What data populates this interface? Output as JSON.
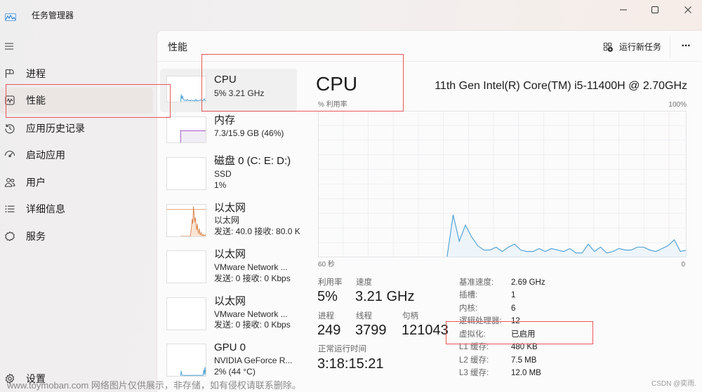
{
  "window": {
    "title": "任务管理器",
    "app_icon": "task-manager-icon"
  },
  "sidebar": {
    "menu_icon": "hamburger-icon",
    "items": [
      {
        "label": "进程",
        "icon": "processes-icon",
        "selected": false
      },
      {
        "label": "性能",
        "icon": "performance-icon",
        "selected": true
      },
      {
        "label": "应用历史记录",
        "icon": "history-icon",
        "selected": false
      },
      {
        "label": "启动应用",
        "icon": "startup-icon",
        "selected": false
      },
      {
        "label": "用户",
        "icon": "users-icon",
        "selected": false
      },
      {
        "label": "详细信息",
        "icon": "details-icon",
        "selected": false
      },
      {
        "label": "服务",
        "icon": "services-icon",
        "selected": false
      }
    ],
    "settings": {
      "label": "设置",
      "icon": "gear-icon"
    }
  },
  "header": {
    "title": "性能",
    "run_new_task": "运行新任务",
    "more": "···"
  },
  "devices": [
    {
      "name": "CPU",
      "line1": "5% 3.21 GHz",
      "line2": "",
      "selected": true,
      "color": "#4a9fd4",
      "fill": "#e9f2fa",
      "graph": {
        "source": "chart_data"
      }
    },
    {
      "name": "内存",
      "line1": "7.3/15.9 GB (46%)",
      "line2": "",
      "selected": false,
      "color": "#9a48c2",
      "fill": "#f1edf4",
      "graph": {
        "values": [
          46,
          46,
          46,
          46,
          46,
          46,
          46,
          46,
          46,
          46,
          46,
          46,
          46,
          46,
          46,
          46,
          46,
          46,
          46,
          46,
          46,
          46,
          46,
          46,
          46,
          46,
          46,
          46,
          46,
          46,
          46,
          46,
          46,
          46,
          46,
          46,
          46,
          46,
          46,
          46
        ]
      }
    },
    {
      "name": "磁盘 0 (C: E: D:)",
      "line1": "SSD",
      "line2": "1%",
      "selected": false,
      "color": "#4da64d",
      "fill": "#eef7ee",
      "graph": {
        "values": []
      }
    },
    {
      "name": "以太网",
      "line1": "以太网",
      "line2": "发送: 40.0 接收: 80.0 K",
      "selected": false,
      "color": "#d8824a",
      "fill": "#fbe4d4",
      "graph": {
        "reference_percent": 85,
        "values": [
          0,
          0,
          0,
          0,
          0,
          0,
          0,
          0,
          0,
          0,
          0,
          0,
          0,
          0,
          0,
          0,
          15,
          30,
          55,
          40,
          95,
          70,
          45,
          60,
          35,
          20,
          40,
          15,
          10,
          25,
          8,
          5,
          12,
          3,
          2,
          6,
          2,
          4,
          2,
          5
        ]
      }
    },
    {
      "name": "以太网",
      "line1": "VMware Network ...",
      "line2": "发送: 0 接收: 0 Kbps",
      "selected": false,
      "color": "#d8824a",
      "fill": "#fbe4d4",
      "graph": {
        "values": []
      }
    },
    {
      "name": "以太网",
      "line1": "VMware Network ...",
      "line2": "发送: 0 接收: 0 Kbps",
      "selected": false,
      "color": "#d8824a",
      "fill": "#fbe4d4",
      "graph": {
        "values": []
      }
    },
    {
      "name": "GPU 0",
      "line1": "NVIDIA GeForce R...",
      "line2": "2% (44 °C)",
      "selected": false,
      "color": "#4a9fd4",
      "fill": "#e9f2fa",
      "graph": {
        "values": [
          1,
          16,
          3,
          2,
          2,
          2,
          1,
          2,
          1,
          2,
          2,
          1,
          2,
          2,
          1,
          2,
          2,
          1,
          2,
          2,
          1,
          2,
          2,
          1,
          2,
          2,
          1,
          2,
          2,
          2,
          1,
          2,
          2,
          1,
          2,
          2,
          20,
          4,
          28,
          3
        ]
      }
    }
  ],
  "detail": {
    "title": "CPU",
    "model": "11th Gen Intel(R) Core(TM) i5-11400H @ 2.70GHz",
    "stats": {
      "utilization": {
        "label": "利用率",
        "value": "5%"
      },
      "speed": {
        "label": "速度",
        "value": "3.21 GHz"
      },
      "processes": {
        "label": "进程",
        "value": "249"
      },
      "threads": {
        "label": "线程",
        "value": "3799"
      },
      "handles": {
        "label": "句柄",
        "value": "121043"
      },
      "uptime": {
        "label": "正常运行时间",
        "value": "3:18:15:21"
      }
    },
    "specs": [
      {
        "label": "基准速度:",
        "value": "2.69 GHz"
      },
      {
        "label": "插槽:",
        "value": "1"
      },
      {
        "label": "内核:",
        "value": "6"
      },
      {
        "label": "逻辑处理器:",
        "value": "12"
      },
      {
        "label": "虚拟化:",
        "value": "已启用"
      },
      {
        "label": "L1 缓存:",
        "value": "480 KB"
      },
      {
        "label": "L2 缓存:",
        "value": "7.5 MB"
      },
      {
        "label": "L3 缓存:",
        "value": "12.0 MB"
      }
    ]
  },
  "chart_data": {
    "type": "area",
    "title": "CPU",
    "ylabel": "% 利用率",
    "y_max_label": "100%",
    "xlabel_left": "60 秒",
    "xlabel_right": "0",
    "ylim": [
      0,
      100
    ],
    "x_window_seconds": 60,
    "sample_interval_s": 1,
    "grid": true,
    "grid_color": "#eceff1",
    "border_color": "#dfe3e6",
    "series": [
      {
        "name": "CPU 利用率",
        "color": "#4a9fd4",
        "fill": "#edf4fa",
        "values": [
          0,
          29,
          11,
          22,
          14,
          8,
          5,
          5,
          7,
          4,
          7,
          9,
          5,
          4,
          4,
          6,
          4,
          6,
          5,
          4,
          6,
          3,
          3,
          9,
          4,
          7,
          3,
          4,
          6,
          5,
          5,
          7,
          7,
          5,
          4,
          6,
          8,
          12,
          4,
          5
        ]
      }
    ]
  },
  "annotation_color": "#e8585a",
  "watermark": {
    "text": "www.toymoban.com 网络图片仅供展示，非存储，如有侵权请联系删除。",
    "credit": "CSDN @奕雨."
  }
}
